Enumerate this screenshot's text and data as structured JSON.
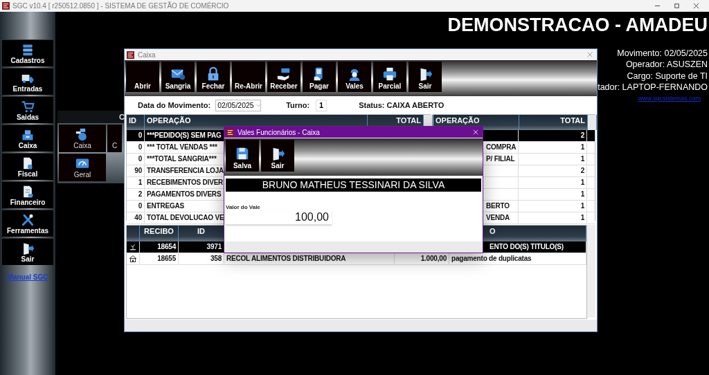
{
  "app_window": {
    "title": "SGC v10.4 [ r250512.0850 ] - SISTEMA DE GESTÃO DE COMÉRCIO"
  },
  "sidebar": {
    "items": [
      "Cadastros",
      "Entradas",
      "Saidas",
      "Caixa",
      "Fiscal",
      "Financeiro",
      "Ferramentas",
      "Sair"
    ],
    "link": "Manual SGC"
  },
  "header": {
    "company": "DEMONSTRACAO - AMADEU",
    "info": [
      "Movimento: 02/05/2025",
      "Operador: ASUSZEN",
      "Cargo: Suporte de TI",
      "tador: LAPTOP-FERNANDO"
    ],
    "link": "www.sgcsistemas.com"
  },
  "submenu": {
    "title": "C",
    "items": [
      "Caixa",
      "C",
      "Geral"
    ]
  },
  "caixa_window": {
    "title": "Caixa",
    "toolbar": [
      "Abrir",
      "Sangria",
      "Fechar",
      "Re-Abrir",
      "Receber",
      "Pagar",
      "Vales",
      "Parcial",
      "Sair"
    ],
    "date_label": "Data do Movimento:",
    "date": "02/05/2025",
    "shift_label": "Turno:",
    "shift": "1",
    "status": "Status: CAIXA ABERTO",
    "left_grid": {
      "columns": [
        "ID",
        "OPERAÇÃO",
        "TOTAL"
      ],
      "rows": [
        {
          "id": "0",
          "operation": "***PEDIDO(S) SEM PAG",
          "selected": true
        },
        {
          "id": "0",
          "operation": "*** TOTAL VENDAS ***",
          "selected": false
        },
        {
          "id": "0",
          "operation": "***TOTAL SANGRIA***",
          "selected": false
        },
        {
          "id": "90",
          "operation": "TRANSFERENCIA LOJA",
          "selected": false
        },
        {
          "id": "1",
          "operation": "RECEBIMENTOS DIVER",
          "selected": false
        },
        {
          "id": "2",
          "operation": "PAGAMENTOS DIVERS",
          "selected": false
        },
        {
          "id": "0",
          "operation": "ENTREGAS",
          "selected": false
        },
        {
          "id": "40",
          "operation": "TOTAL DEVOLUCAO VE",
          "selected": false
        }
      ]
    },
    "right_grid": {
      "columns": [
        "OPERAÇÃO",
        "TOTAL"
      ],
      "rows": [
        {
          "total": "2",
          "selected": true
        },
        {
          "operation": "COMPRA",
          "total": "1",
          "selected": false
        },
        {
          "operation": "P/ FILIAL",
          "total": "1",
          "selected": false
        },
        {
          "total": "2",
          "selected": false
        },
        {
          "total": "1",
          "selected": false
        },
        {
          "total": "1",
          "selected": false
        },
        {
          "operation": "BERTO",
          "total": "1",
          "selected": false
        },
        {
          "operation": "VENDA",
          "total": "1",
          "selected": false
        }
      ]
    },
    "receipts": {
      "columns": [
        "RECIBO",
        "ID",
        "O"
      ],
      "rows": [
        {
          "recibo": "18654",
          "id": "3971",
          "note": "ENTO DO(S) TITULO(S)",
          "covered": true,
          "selected": true
        },
        {
          "recibo": "18655",
          "id": "358",
          "description": "RECOL ALIMENTOS DISTRIBUIDORA",
          "amount": "1.000,00",
          "note": "pagamento de duplicatas",
          "covered": false,
          "selected": false
        }
      ]
    }
  },
  "dialog": {
    "title": "Vales Funcionários - Caixa",
    "toolbar": [
      "Salva",
      "Sair"
    ],
    "employee": "BRUNO MATHEUS TESSINARI DA SILVA",
    "amount_label": "Valor do Vale",
    "amount": "100,00"
  }
}
